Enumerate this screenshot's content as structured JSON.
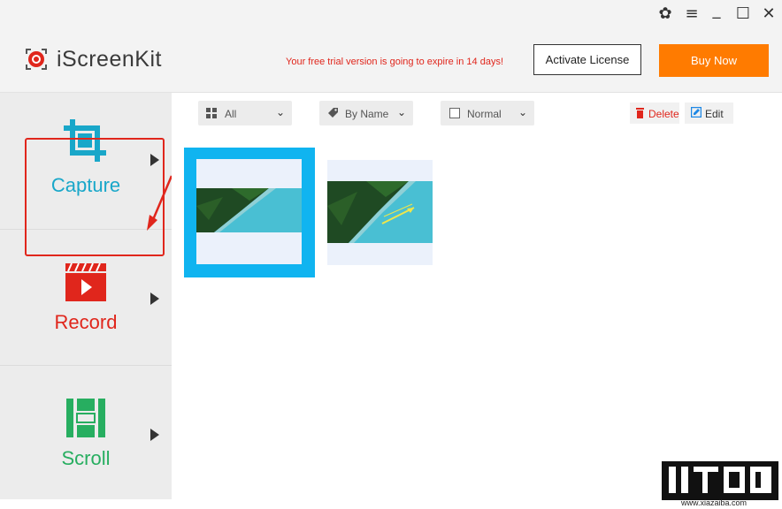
{
  "window": {
    "controls": {
      "settings_glyph": "✿",
      "menu_glyph": "≡",
      "minimize_glyph": "_",
      "maximize_glyph": "☐",
      "close_glyph": "✕"
    }
  },
  "header": {
    "app_name": "iScreenKit",
    "trial_message": "Your free trial version is going to expire in 14 days!",
    "activate_label": "Activate License",
    "buy_label": "Buy Now"
  },
  "sidebar": {
    "items": [
      {
        "label": "Capture",
        "icon": "crop-icon",
        "color": "#19a7c9"
      },
      {
        "label": "Record",
        "icon": "video-clapper-icon",
        "color": "#e0261c"
      },
      {
        "label": "Scroll",
        "icon": "scroll-capture-icon",
        "color": "#27ae60"
      }
    ]
  },
  "toolbar": {
    "filter_label": "All",
    "sort_label": "By Name",
    "view_label": "Normal",
    "delete_label": "Delete",
    "edit_label": "Edit"
  },
  "watermark": {
    "url": "www.xiazaiba.com"
  },
  "colors": {
    "accent_blue": "#19a7c9",
    "accent_red": "#e0261c",
    "accent_green": "#27ae60",
    "buy_orange": "#ff7b00",
    "selection_blue": "#10b4f0"
  }
}
